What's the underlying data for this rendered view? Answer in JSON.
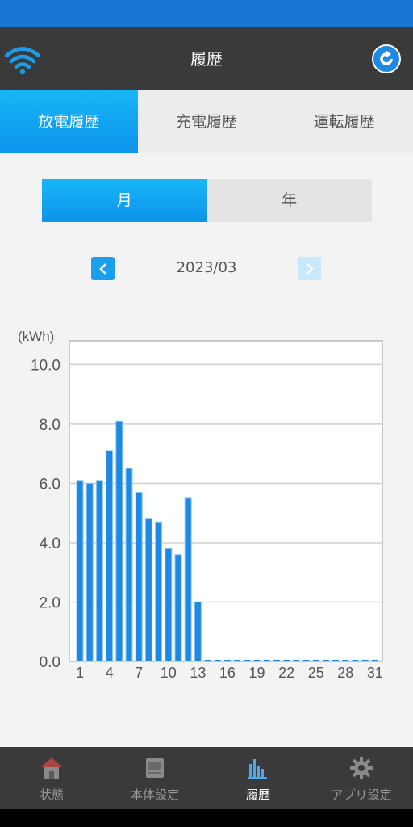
{
  "header": {
    "title": "履歴"
  },
  "tabs": [
    {
      "label": "放電履歴",
      "active": true
    },
    {
      "label": "充電履歴",
      "active": false
    },
    {
      "label": "運転履歴",
      "active": false
    }
  ],
  "period": {
    "month_label": "月",
    "year_label": "年",
    "selected": "月"
  },
  "month_nav": {
    "current": "2023/03"
  },
  "colors": {
    "accent": "#0d93ec",
    "bar": "#1e88e5",
    "header": "#3a3a3a"
  },
  "chart_data": {
    "type": "bar",
    "ylabel": "(kWh)",
    "ylim": [
      0,
      10.8
    ],
    "yticks": [
      "0.0",
      "2.0",
      "4.0",
      "6.0",
      "8.0",
      "10.0"
    ],
    "xticks": [
      "1",
      "4",
      "7",
      "10",
      "13",
      "16",
      "19",
      "22",
      "25",
      "28",
      "31"
    ],
    "categories": [
      1,
      2,
      3,
      4,
      5,
      6,
      7,
      8,
      9,
      10,
      11,
      12,
      13,
      14,
      15,
      16,
      17,
      18,
      19,
      20,
      21,
      22,
      23,
      24,
      25,
      26,
      27,
      28,
      29,
      30,
      31
    ],
    "values": [
      6.1,
      6.0,
      6.1,
      7.1,
      8.1,
      6.5,
      5.7,
      4.8,
      4.7,
      3.8,
      3.6,
      5.5,
      2.0,
      0,
      0,
      0,
      0,
      0,
      0,
      0,
      0,
      0,
      0,
      0,
      0,
      0,
      0,
      0,
      0,
      0,
      0
    ],
    "grid": true
  },
  "bottom_nav": [
    {
      "label": "状態",
      "icon": "house-icon",
      "active": false
    },
    {
      "label": "本体設定",
      "icon": "device-icon",
      "active": false
    },
    {
      "label": "履歴",
      "icon": "bar-chart-icon",
      "active": true
    },
    {
      "label": "アプリ設定",
      "icon": "gear-icon",
      "active": false
    }
  ]
}
